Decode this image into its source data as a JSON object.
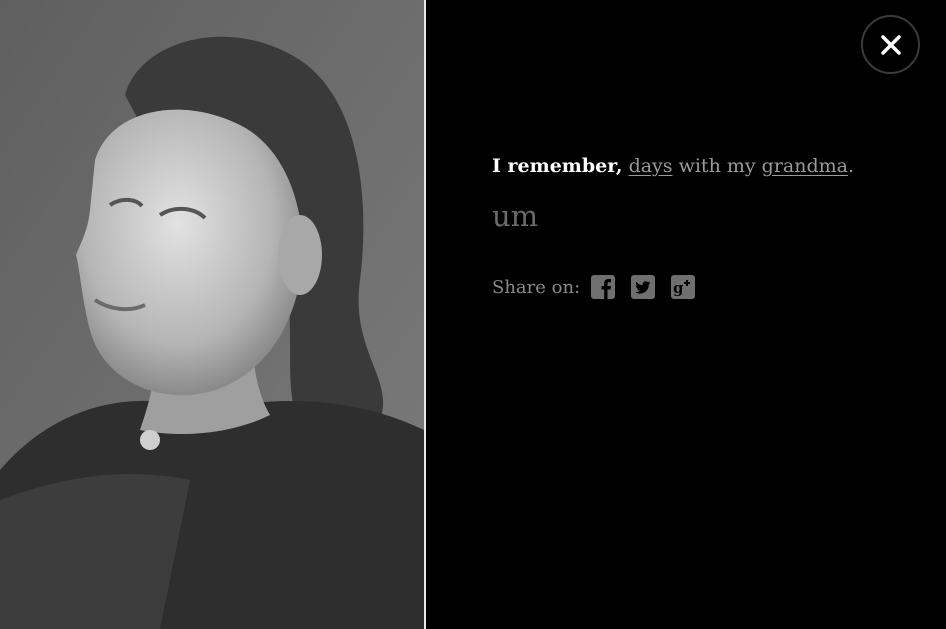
{
  "photo": {
    "description_icon": "portrait-photo"
  },
  "close": {
    "icon": "close-icon"
  },
  "headline": {
    "lead": "I remember,",
    "link1": "days",
    "middle": "with my",
    "link2": "grandma",
    "end": "."
  },
  "message": "um",
  "share": {
    "label": "Share on:",
    "icons": [
      "facebook-icon",
      "twitter-icon",
      "google-plus-icon"
    ]
  },
  "colors": {
    "background": "#000000",
    "link": "#9a9a9a",
    "muted": "#6a6a6a",
    "icon": "#6f6f6f"
  }
}
